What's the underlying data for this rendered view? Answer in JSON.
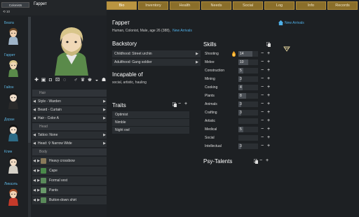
{
  "top": {
    "colonist_button": "Colonists",
    "pawn_name": "Гаррет",
    "counter": "10"
  },
  "pawn_list": [
    {
      "name": "Беата",
      "hair": "#6b4a2a",
      "skin": "#f0cfae",
      "body": "#9fb4c8"
    },
    {
      "name": "Гаррет",
      "hair": "#d8c58a",
      "skin": "#f0d8b6",
      "body": "#5a8a4a"
    },
    {
      "name": "Гайон",
      "hair": "#1a1a1a",
      "skin": "#f2e0cc",
      "body": "#2a2a2a"
    },
    {
      "name": "Доран",
      "hair": "#111111",
      "skin": "#f5e2ce",
      "body": "#2d6b86"
    },
    {
      "name": "Клин",
      "hair": "#1a1a1a",
      "skin": "#f2dcc4",
      "body": "#d6d2c8"
    },
    {
      "name": "Ликаэль",
      "hair": "#a4502a",
      "skin": "#f2d4b6",
      "body": "#c43a2a"
    }
  ],
  "icons": [
    "first-aid-icon",
    "save-icon",
    "floppy-icon",
    "dice-icon",
    "male-icon",
    "female-icon",
    "crown-icon",
    "crown-alt-icon",
    "helmet-icon"
  ],
  "customization": {
    "hair_header": "Hair",
    "style": "Style - Warden",
    "beard": "Beard - Curtain",
    "hair_color": "Hair - Color A",
    "head_header": "Head",
    "tattoo": "Tattoo: None",
    "head": "Head: ⚲ Narrow Wide",
    "body_header": "Body",
    "apparel": [
      {
        "label": "Heavy crossbow",
        "color": "#8a7a5a"
      },
      {
        "label": "Cape",
        "color": "#4a8a4a"
      },
      {
        "label": "Formal vest",
        "color": "#5a8a5a"
      },
      {
        "label": "Pants",
        "color": "#6a9a6a"
      },
      {
        "label": "Button-down shirt",
        "color": "#5a8a5a"
      }
    ]
  },
  "tabs": [
    {
      "label": "Bio",
      "active": true
    },
    {
      "label": "Inventory",
      "active": false
    },
    {
      "label": "Health",
      "active": false
    },
    {
      "label": "Needs",
      "active": false
    },
    {
      "label": "Social",
      "active": false
    },
    {
      "label": "Log",
      "active": false
    },
    {
      "label": "Info",
      "active": false
    },
    {
      "label": "Records",
      "active": false
    }
  ],
  "bio": {
    "name": "Гаррет",
    "description": "Human, Colonist, Male, age 26 (388),",
    "description_link": "New Arrivals",
    "new_arrivals": "New Arrivals",
    "backstory_title": "Backstory",
    "childhood": "Childhood: Street urchin",
    "adulthood": "Adulthood: Gang soldier",
    "incapable_title": "Incapable of",
    "incapable_text": "social, artistic, hauling",
    "traits_title": "Traits",
    "traits": [
      "Optimist",
      "Nimble",
      "Night owl"
    ],
    "skills_title": "Skills",
    "psy_title": "Psy-Talents"
  },
  "skills": [
    {
      "name": "Shooting",
      "value": "14",
      "level": 14,
      "passion": true
    },
    {
      "name": "Melee",
      "value": "10",
      "level": 10,
      "passion": false
    },
    {
      "name": "Construction",
      "value": "5",
      "level": 5,
      "passion": false
    },
    {
      "name": "Mining",
      "value": "3",
      "level": 3,
      "passion": false
    },
    {
      "name": "Cooking",
      "value": "4",
      "level": 4,
      "passion": false
    },
    {
      "name": "Plants",
      "value": "8",
      "level": 8,
      "passion": false
    },
    {
      "name": "Animals",
      "value": "3",
      "level": 3,
      "passion": false
    },
    {
      "name": "Crafting",
      "value": "3",
      "level": 3,
      "passion": false
    },
    {
      "name": "Artistic",
      "value": "",
      "level": 0,
      "passion": false
    },
    {
      "name": "Medical",
      "value": "5",
      "level": 5,
      "passion": false
    },
    {
      "name": "Social",
      "value": "",
      "level": 0,
      "passion": false
    },
    {
      "name": "Intellectual",
      "value": "3",
      "level": 3,
      "passion": false
    }
  ],
  "colors": {
    "tab_bg": "#8a6e2a",
    "tab_active": "#b99441",
    "link": "#4fb0e8",
    "name_blue": "#5db8e6"
  }
}
